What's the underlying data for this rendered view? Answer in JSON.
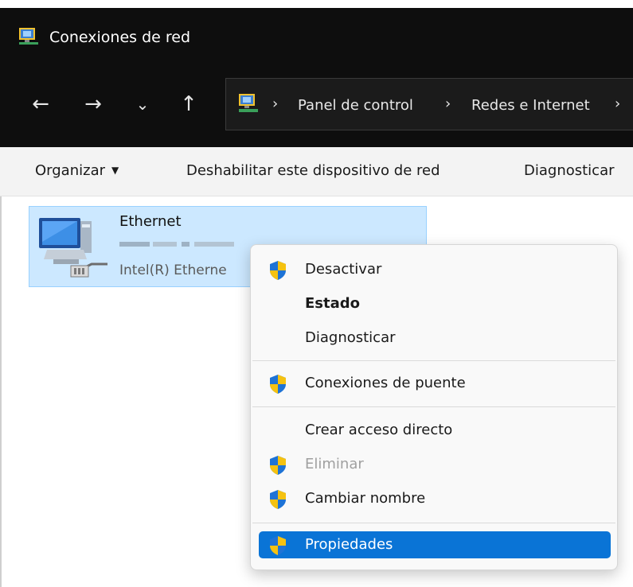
{
  "window": {
    "title": "Conexiones de red",
    "title_icon": "network-connections-icon"
  },
  "nav": {
    "back_icon": "←",
    "forward_icon": "→",
    "recent_icon": "⌄",
    "up_icon": "↑",
    "breadcrumb_sep": "›",
    "breadcrumbs": [
      "Panel de control",
      "Redes e Internet"
    ]
  },
  "toolbar": {
    "organize_label": "Organizar",
    "disable_label": "Deshabilitar este dispositivo de red",
    "diagnose_label": "Diagnosticar"
  },
  "connection": {
    "name": "Ethernet",
    "adapter": "Intel(R) Etherne"
  },
  "context_menu": {
    "items": [
      {
        "label": "Desactivar",
        "shield": true
      },
      {
        "label": "Estado",
        "bold": true
      },
      {
        "label": "Diagnosticar"
      },
      {
        "label": "Conexiones de puente",
        "shield": true
      },
      {
        "label": "Crear acceso directo"
      },
      {
        "label": "Eliminar",
        "shield": true,
        "disabled": true
      },
      {
        "label": "Cambiar nombre",
        "shield": true
      },
      {
        "label": "Propiedades",
        "shield": true,
        "selected": true
      }
    ]
  },
  "colors": {
    "titlebar_bg": "#0e0e0e",
    "selection_bg": "#cce8ff",
    "menu_highlight": "#0a74d6",
    "shield_blue": "#1e73d6",
    "shield_yellow": "#f5c211"
  }
}
